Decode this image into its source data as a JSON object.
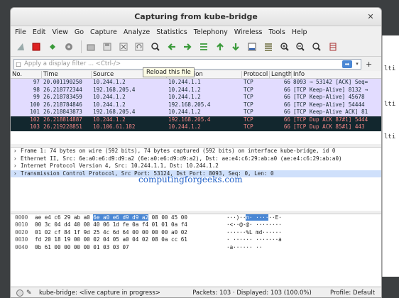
{
  "window": {
    "title": "Capturing from kube-bridge",
    "close_label": "✕"
  },
  "menu": [
    "File",
    "Edit",
    "View",
    "Go",
    "Capture",
    "Analyze",
    "Statistics",
    "Telephony",
    "Wireless",
    "Tools",
    "Help"
  ],
  "toolbar_icons": [
    "shark-fin-start-icon",
    "stop-capture-icon",
    "restart-capture-icon",
    "capture-options-icon",
    "open-file-icon",
    "save-file-icon",
    "close-file-icon",
    "reload-file-icon",
    "find-packet-icon",
    "go-back-icon",
    "go-forward-icon",
    "go-to-packet-icon",
    "go-first-icon",
    "go-last-icon",
    "autoscroll-icon",
    "colorize-icon",
    "zoom-in-icon",
    "zoom-out-icon",
    "zoom-normal-icon",
    "resize-columns-icon"
  ],
  "tooltip": "Reload this file",
  "filter": {
    "placeholder": "Apply a display filter ... <Ctrl-/>",
    "plus": "+"
  },
  "columns": [
    "No.",
    "Time",
    "Source",
    "Destination",
    "Protocol",
    "Length",
    "Info"
  ],
  "packets": [
    {
      "no": "97",
      "time": "20.001190250",
      "src": "10.244.1.2",
      "dst": "10.244.1.1",
      "proto": "TCP",
      "len": "66",
      "info": "8093 → 53142 [ACK] Seq=",
      "kind": "normal"
    },
    {
      "no": "98",
      "time": "26.218772344",
      "src": "192.168.205.4",
      "dst": "10.244.1.2",
      "proto": "TCP",
      "len": "66",
      "info": "[TCP Keep-Alive] 8132 →",
      "kind": "normal"
    },
    {
      "no": "99",
      "time": "26.218783459",
      "src": "10.244.1.2",
      "dst": "10.244.1.2",
      "proto": "TCP",
      "len": "66",
      "info": "[TCP Keep-Alive] 45678",
      "kind": "normal"
    },
    {
      "no": "100",
      "time": "26.218784846",
      "src": "10.244.1.2",
      "dst": "192.168.205.4",
      "proto": "TCP",
      "len": "66",
      "info": "[TCP Keep-Alive] 54444",
      "kind": "normal"
    },
    {
      "no": "101",
      "time": "26.218843873",
      "src": "192.168.205.4",
      "dst": "10.244.1.2",
      "proto": "TCP",
      "len": "66",
      "info": "[TCP Keep-Alive ACK] 81",
      "kind": "normal"
    },
    {
      "no": "102",
      "time": "26.218814887",
      "src": "10.244.1.2",
      "dst": "192.168.205.4",
      "proto": "TCP",
      "len": "66",
      "info": "[TCP Dup ACK 87#1] 5444",
      "kind": "bad"
    },
    {
      "no": "103",
      "time": "26.219228851",
      "src": "10.106.61.182",
      "dst": "10.244.1.2",
      "proto": "TCP",
      "len": "66",
      "info": "[TCP Dup ACK 85#1] 443",
      "kind": "bad"
    }
  ],
  "details": [
    {
      "text": "Frame 1: 74 bytes on wire (592 bits), 74 bytes captured (592 bits) on interface kube-bridge, id 0",
      "selected": false
    },
    {
      "text": "Ethernet II, Src: 6e:a0:e6:d9:d9:a2 (6e:a0:e6:d9:d9:a2), Dst: ae:e4:c6:29:ab:a0 (ae:e4:c6:29:ab:a0)",
      "selected": false
    },
    {
      "text": "Internet Protocol Version 4, Src: 10.244.1.1, Dst: 10.244.1.2",
      "selected": false
    },
    {
      "text": "Transmission Control Protocol, Src Port: 53124, Dst Port: 8093, Seq: 0, Len: 0",
      "selected": true
    }
  ],
  "watermark": "computingforgeeks.com",
  "bytes": [
    {
      "off": "0000",
      "pre": "ae e4 c6 29 ab a0 ",
      "hl": "6e a0  e6 d9 d9 a2",
      "post": " 08 00 45 00",
      "ascii_pre": "···)··",
      "ascii_hl": "n· ····",
      "ascii_post": "··E·"
    },
    {
      "off": "0010",
      "pre": "00 3c 04 d4 40 00 40 06  1d fe 0a f4 01 01 0a f4",
      "hl": "",
      "post": "",
      "ascii_pre": "·<··@·@· ········",
      "ascii_hl": "",
      "ascii_post": ""
    },
    {
      "off": "0020",
      "pre": "01 02 cf 84 1f 9d 25 4c  6d 64 00 00 00 00 a0 02",
      "hl": "",
      "post": "",
      "ascii_pre": "······%L md······",
      "ascii_hl": "",
      "ascii_post": ""
    },
    {
      "off": "0030",
      "pre": "fd 20 18 19 00 00 02 04  05 a0 04 02 08 0a cc 61",
      "hl": "",
      "post": "",
      "ascii_pre": "· ······ ·······a",
      "ascii_hl": "",
      "ascii_post": ""
    },
    {
      "off": "0040",
      "pre": "0b 61 00 00 00 00 01 03  03 07",
      "hl": "",
      "post": "",
      "ascii_pre": "·a······ ··",
      "ascii_hl": "",
      "ascii_post": ""
    }
  ],
  "status": {
    "interface": "kube-bridge: <live capture in progress>",
    "packets": "Packets: 103 · Displayed: 103 (100.0%)",
    "profile": "Profile: Default"
  },
  "background_fragments": [
    "lti",
    "lti",
    "lti"
  ]
}
